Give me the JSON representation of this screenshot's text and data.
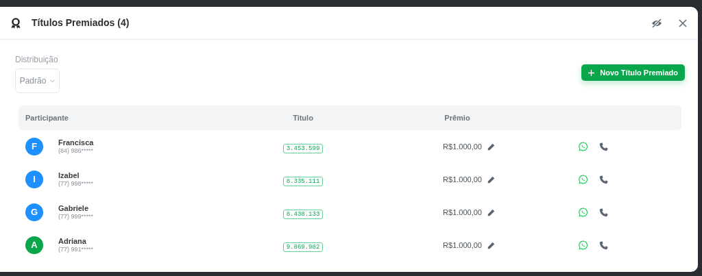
{
  "modal": {
    "title": "Títulos Premiados (4)"
  },
  "distribution": {
    "label": "Distribuição",
    "value": "Padrão"
  },
  "new_button": {
    "label": "Novo Título Premiado"
  },
  "table": {
    "columns": [
      "Participante",
      "Titulo",
      "Prêmio"
    ],
    "rows": [
      {
        "initial": "F",
        "color": "#1e90ff",
        "name": "Francisca",
        "phone": "(84) 986*****",
        "ticket": "3.453.599",
        "prize": "R$1.000,00"
      },
      {
        "initial": "I",
        "color": "#1e90ff",
        "name": "Izabel",
        "phone": "(77) 998*****",
        "ticket": "8.335.111",
        "prize": "R$1.000,00"
      },
      {
        "initial": "G",
        "color": "#1e90ff",
        "name": "Gabriele",
        "phone": "(77) 999*****",
        "ticket": "8.438.133",
        "prize": "R$1.000,00"
      },
      {
        "initial": "A",
        "color": "#0aa64c",
        "name": "Adriana",
        "phone": "(77) 991*****",
        "ticket": "9.869.982",
        "prize": "R$1.000,00"
      }
    ]
  }
}
